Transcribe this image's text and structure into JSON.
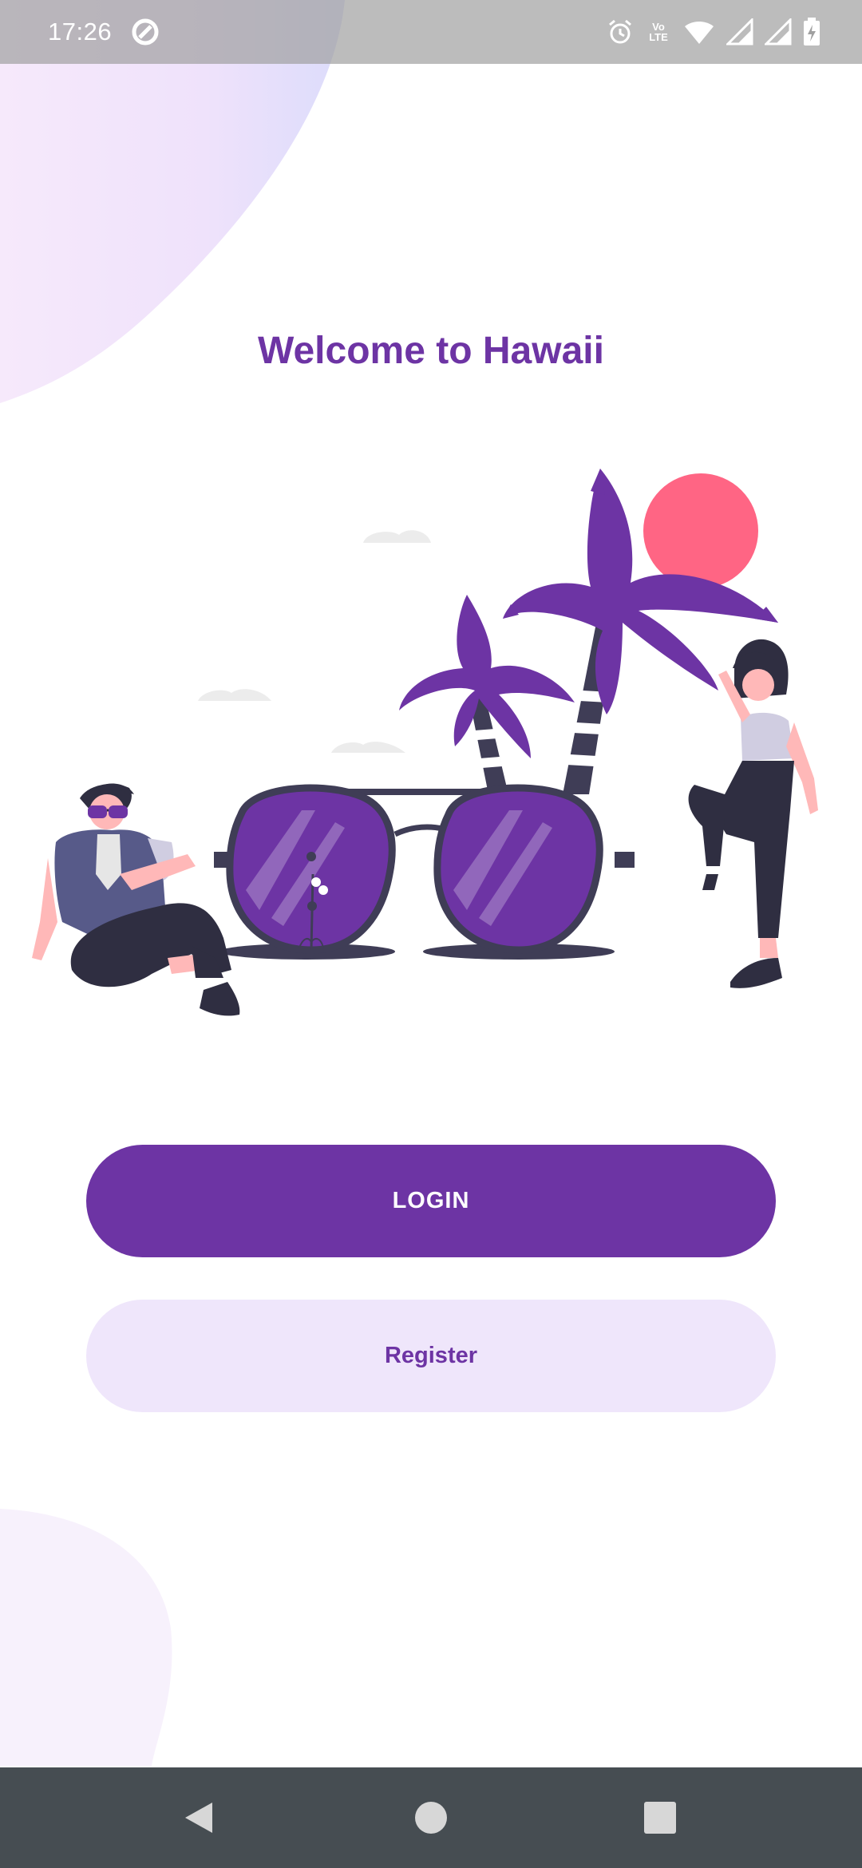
{
  "status_bar": {
    "time": "17:26",
    "lte_top": "Vo",
    "lte_bottom": "LTE",
    "icons": [
      "data-saver-icon",
      "alarm-icon",
      "volte-icon",
      "wifi-icon",
      "signal-icon",
      "signal-icon",
      "battery-charging-icon"
    ]
  },
  "welcome": {
    "title": "Welcome to Hawaii"
  },
  "illustration": {
    "icon": "hawaii-beach-illustration"
  },
  "actions": {
    "login_label": "LOGIN",
    "register_label": "Register"
  },
  "nav_bar": {
    "icons": [
      "back-icon",
      "home-icon",
      "recents-icon"
    ]
  },
  "colors": {
    "primary": "#6d34a4",
    "secondary_bg": "#efe6fb",
    "sun": "#ff6584",
    "dark": "#3f3d56",
    "nav_bar": "#464d52"
  }
}
